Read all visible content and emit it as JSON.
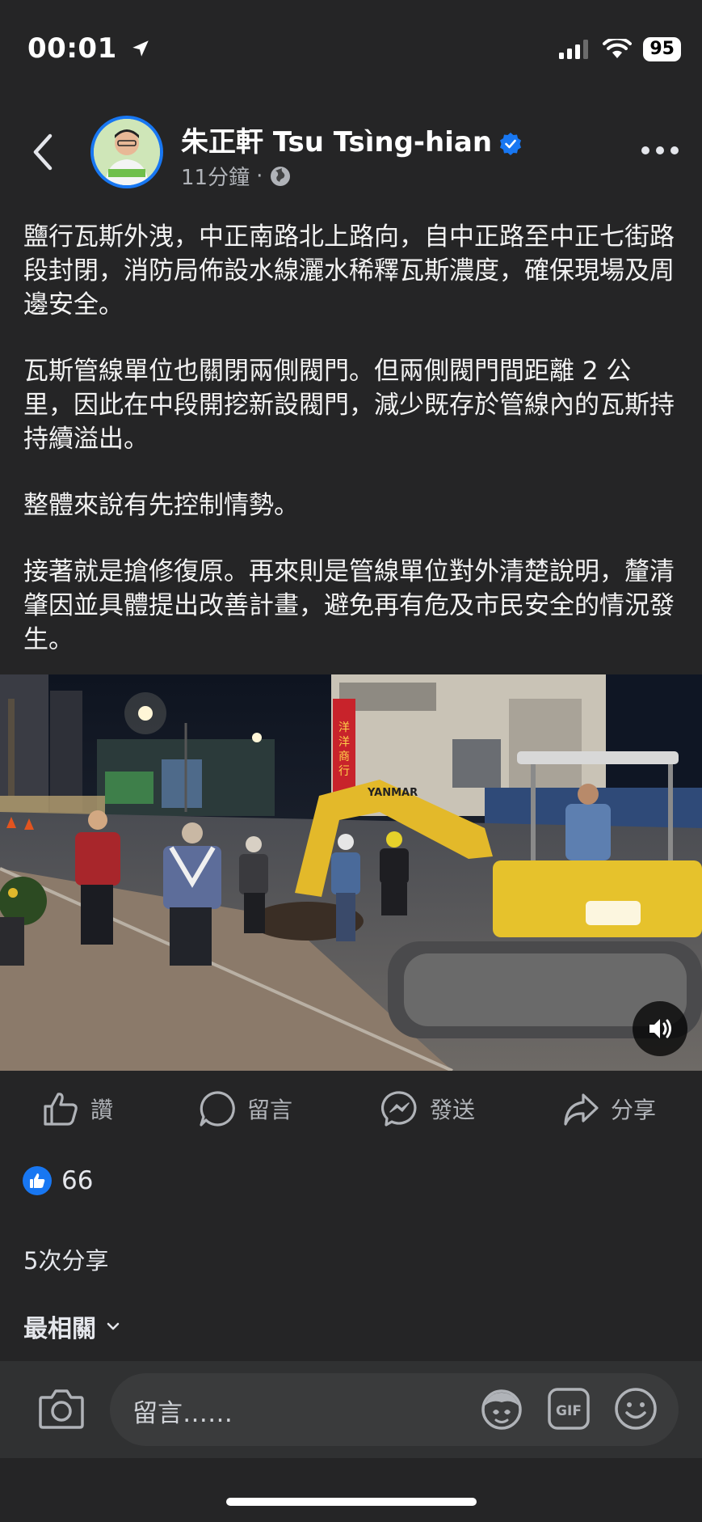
{
  "status_bar": {
    "time": "00:01",
    "battery": "95",
    "icons": [
      "location-arrow-icon",
      "signal-bars-icon",
      "wifi-icon",
      "battery-icon"
    ]
  },
  "header": {
    "author": "朱正軒 Tsu Tsìng-hian",
    "time_ago": "11分鐘",
    "separator": "·",
    "audience_icon": "globe-icon",
    "verified_icon": "verified-badge-icon",
    "more_icon": "more-dots-icon",
    "back_icon": "chevron-left-icon"
  },
  "post": {
    "paragraphs": [
      "鹽行瓦斯外洩，中正南路北上路向，自中正路至中正七街路段封閉，消防局佈設水線灑水稀釋瓦斯濃度，確保現場及周邊安全。",
      "瓦斯管線單位也關閉兩側閥門。但兩側閥門間距離 2 公里，因此在中段開挖新設閥門，減少既存於管線內的瓦斯持持續溢出。",
      "整體來說有先控制情勢。",
      "接著就是搶修復原。再來則是管線單位對外清楚說明，釐清肇因並具體提出改善計畫，避免再有危及市民安全的情況發生。"
    ],
    "photo_signs": [
      "洋洋商行",
      "YANMAR"
    ],
    "photo_sound_icon": "speaker-icon"
  },
  "actions": [
    {
      "label": "讚",
      "icon": "thumbs-up-icon"
    },
    {
      "label": "留言",
      "icon": "comment-bubble-icon"
    },
    {
      "label": "發送",
      "icon": "messenger-icon"
    },
    {
      "label": "分享",
      "icon": "share-arrow-icon"
    }
  ],
  "reactions": {
    "count": "66",
    "icon": "like-reaction-icon"
  },
  "shares": "5次分享",
  "sort": {
    "label": "最相關",
    "icon": "chevron-down-icon"
  },
  "composer": {
    "placeholder": "留言……",
    "icons": [
      "camera-icon",
      "avatar-sticker-icon",
      "gif-icon",
      "emoji-icon"
    ]
  },
  "colors": {
    "background": "#252526",
    "accent": "#1877f2",
    "secondary_text": "#b0b3b8"
  }
}
